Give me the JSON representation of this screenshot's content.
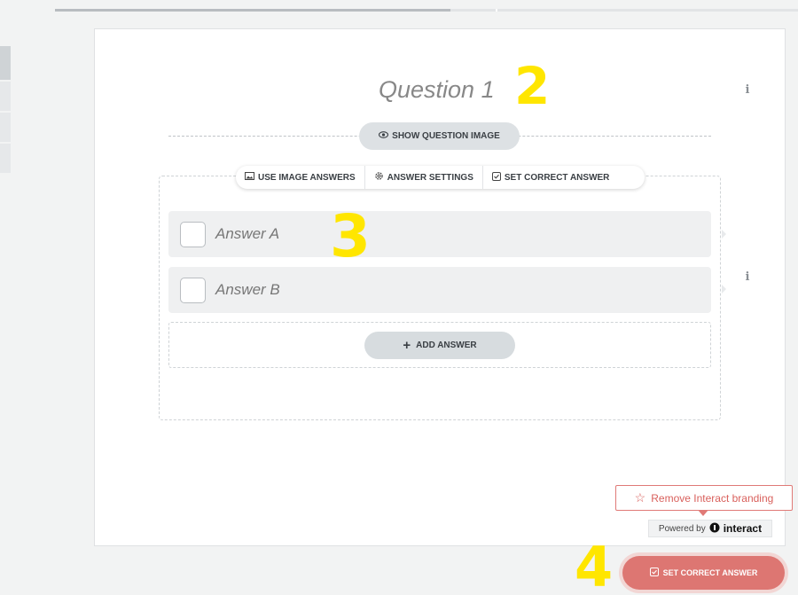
{
  "question": {
    "title": "Question 1",
    "show_image_label": "SHOW QUESTION IMAGE",
    "show_image_icon": "eye-icon"
  },
  "toolbar": {
    "items": [
      {
        "label": "USE IMAGE ANSWERS",
        "icon": "image-icon"
      },
      {
        "label": "ANSWER SETTINGS",
        "icon": "gear-icon"
      },
      {
        "label": "SET CORRECT ANSWER",
        "icon": "checkbox-icon"
      }
    ]
  },
  "answers": [
    {
      "label": "Answer A"
    },
    {
      "label": "Answer B"
    }
  ],
  "add_answer_label": "ADD ANSWER",
  "annotations": [
    "2",
    "3",
    "4"
  ],
  "branding": {
    "remove_label": "Remove Interact branding",
    "powered_by": "Powered by",
    "brand_name": "interact"
  },
  "footer": {
    "set_correct_label": "SET CORRECT ANSWER"
  },
  "colors": {
    "accent_red": "#dd7672",
    "annotation_yellow": "#ffe600",
    "answer_bg": "#eff0f1"
  }
}
